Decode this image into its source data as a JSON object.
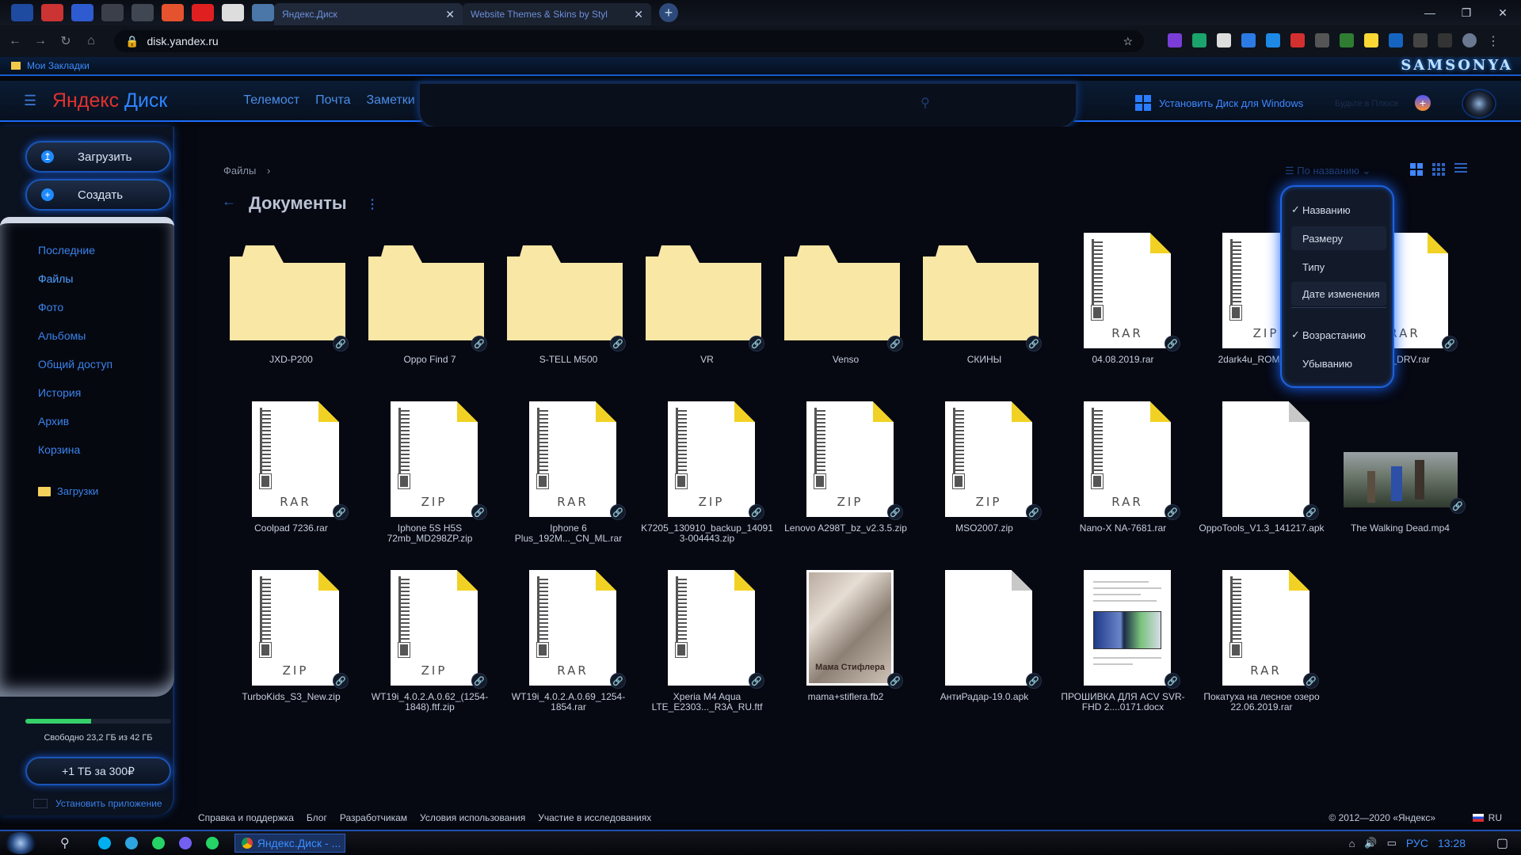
{
  "browser": {
    "tabs": [
      {
        "title": "Яндекс.Диск",
        "close": "✕",
        "active": true
      },
      {
        "title": "Website Themes & Skins by Styl",
        "close": "✕",
        "active": false
      }
    ],
    "new_tab": "+",
    "url": "disk.yandex.ru",
    "bookmark_folder": "Мои Закладки",
    "brand_overlay": "SAMSONYA",
    "window_controls": {
      "minimize": "—",
      "maximize": "❐",
      "close": "✕"
    },
    "nav": {
      "back": "←",
      "forward": "→",
      "reload": "↻",
      "home": "⌂",
      "star": "☆",
      "menu": "⋮"
    }
  },
  "header": {
    "logo_primary": "Яндекс",
    "logo_secondary": "Диск",
    "nav": [
      "Телемост",
      "Почта",
      "Заметки"
    ],
    "install_label": "Установить Диск для Windows",
    "plus_label": "Будьте в Плюсе",
    "plus_badge": "+"
  },
  "sidebar": {
    "upload_label": "Загрузить",
    "create_label": "Создать",
    "upload_icon": "↥",
    "create_icon": "+",
    "items": [
      "Последние",
      "Файлы",
      "Фото",
      "Альбомы",
      "Общий доступ",
      "История",
      "Архив",
      "Корзина"
    ],
    "active_item": "Файлы",
    "downloads_label": "Загрузки",
    "storage": {
      "used_fraction": 0.45,
      "text": "Свободно 23,2 ГБ из 42 ГБ"
    },
    "upgrade_label": "+1 ТБ за 300₽",
    "install_app_label": "Установить приложение"
  },
  "main": {
    "breadcrumb": "Файлы",
    "breadcrumb_sep": "›",
    "title": "Документы",
    "title_menu": "⋮",
    "sort_label": "☰ По названию ⌄",
    "back_arrow": "←",
    "items": [
      {
        "name": "JXD-P200",
        "kind": "folder"
      },
      {
        "name": "Oppo Find 7",
        "kind": "folder"
      },
      {
        "name": "S-TELL M500",
        "kind": "folder"
      },
      {
        "name": "VR",
        "kind": "folder"
      },
      {
        "name": "Venso",
        "kind": "folder"
      },
      {
        "name": "СКИНЫ",
        "kind": "folder"
      },
      {
        "name": "04.08.2019.rar",
        "kind": "archive",
        "ext": "RAR"
      },
      {
        "name": "2dark4u_ROM_...zip",
        "kind": "archive",
        "ext": "ZIP"
      },
      {
        "name": "...AU_DRV.rar",
        "kind": "archive",
        "ext": "RAR"
      },
      {
        "name": "Coolpad 7236.rar",
        "kind": "archive",
        "ext": "RAR"
      },
      {
        "name": "Iphone 5S H5S 72mb_MD298ZP.zip",
        "kind": "archive",
        "ext": "ZIP"
      },
      {
        "name": "Iphone 6 Plus_192M..._CN_ML.rar",
        "kind": "archive",
        "ext": "RAR"
      },
      {
        "name": "K7205_130910_backup_140913-004443.zip",
        "kind": "archive",
        "ext": "ZIP"
      },
      {
        "name": "Lenovo A298T_bz_v2.3.5.zip",
        "kind": "archive",
        "ext": "ZIP"
      },
      {
        "name": "MSO2007.zip",
        "kind": "archive",
        "ext": "ZIP"
      },
      {
        "name": "Nano-X NA-7681.rar",
        "kind": "archive",
        "ext": "RAR"
      },
      {
        "name": "OppoTools_V1.3_141217.apk",
        "kind": "doc"
      },
      {
        "name": "The Walking Dead.mp4",
        "kind": "video"
      },
      {
        "name": "TurboKids_S3_New.zip",
        "kind": "archive",
        "ext": "ZIP"
      },
      {
        "name": "WT19i_4.0.2.A.0.62_(1254-1848).ftf.zip",
        "kind": "archive",
        "ext": "ZIP"
      },
      {
        "name": "WT19i_4.0.2.A.0.69_1254-1854.rar",
        "kind": "archive",
        "ext": "RAR"
      },
      {
        "name": "Xperia M4 Aqua LTE_E2303..._R3A_RU.ftf",
        "kind": "zipnolabel"
      },
      {
        "name": "mama+stiflera.fb2",
        "kind": "photo",
        "caption": "Мама Стифлера"
      },
      {
        "name": "АнтиРадар-19.0.apk",
        "kind": "doc"
      },
      {
        "name": "ПРОШИВКА ДЛЯ ACV SVR-FHD 2....0171.docx",
        "kind": "screenshot"
      },
      {
        "name": "Покатуха на лесное озеро 22.06.2019.rar",
        "kind": "archive",
        "ext": "RAR"
      }
    ],
    "link_icon": "🔗"
  },
  "sort_menu": {
    "field_options": [
      "Названию",
      "Размеру",
      "Типу",
      "Дате изменения"
    ],
    "selected_field": "Названию",
    "order_options": [
      "Возрастанию",
      "Убыванию"
    ],
    "selected_order": "Возрастанию",
    "check": "✓"
  },
  "footer": {
    "links": [
      "Справка и поддержка",
      "Блог",
      "Разработчикам",
      "Условия использования",
      "Участие в исследованиях"
    ],
    "copyright": "© 2012—2020 «Яндекс»",
    "lang": "RU"
  },
  "taskbar": {
    "app_label": "Яндекс.Диск - ...",
    "lang": "РУС",
    "time": "13:28"
  },
  "colors": {
    "accent": "#1d6fff",
    "folder": "#f9e7a6",
    "link": "#3a83ec"
  }
}
